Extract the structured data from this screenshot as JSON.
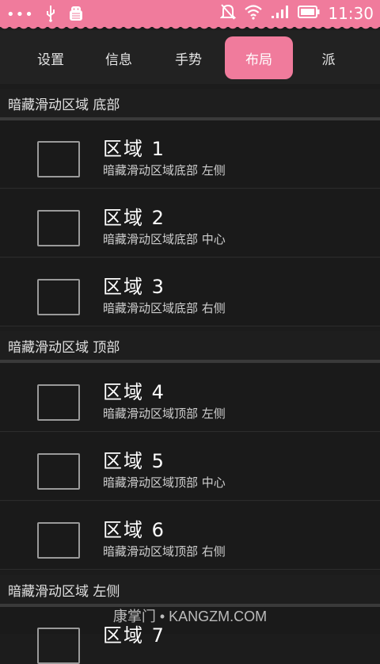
{
  "status_bar": {
    "time": "11:30",
    "icons": [
      "more-dots-icon",
      "usb-icon",
      "android-debug-icon",
      "alarm-off-icon",
      "wifi-icon",
      "signal-icon",
      "battery-icon"
    ]
  },
  "tabs": [
    {
      "label": "设置"
    },
    {
      "label": "信息"
    },
    {
      "label": "手势"
    },
    {
      "label": "布局",
      "active": true
    },
    {
      "label": "派"
    }
  ],
  "sections": [
    {
      "title": "暗藏滑动区域 底部",
      "items": [
        {
          "title": "区域 1",
          "subtitle": "暗藏滑动区域底部 左侧"
        },
        {
          "title": "区域 2",
          "subtitle": "暗藏滑动区域底部 中心"
        },
        {
          "title": "区域 3",
          "subtitle": "暗藏滑动区域底部 右侧"
        }
      ]
    },
    {
      "title": "暗藏滑动区域 顶部",
      "items": [
        {
          "title": "区域 4",
          "subtitle": "暗藏滑动区域顶部 左侧"
        },
        {
          "title": "区域 5",
          "subtitle": "暗藏滑动区域顶部 中心"
        },
        {
          "title": "区域 6",
          "subtitle": "暗藏滑动区域顶部 右侧"
        }
      ]
    },
    {
      "title": "暗藏滑动区域 左侧",
      "items": [
        {
          "title": "区域 7",
          "subtitle": ""
        }
      ]
    }
  ],
  "watermark": "康掌门 • KANGZM.COM",
  "colors": {
    "accent": "#f07b9c",
    "background": "#1c1c1c"
  }
}
